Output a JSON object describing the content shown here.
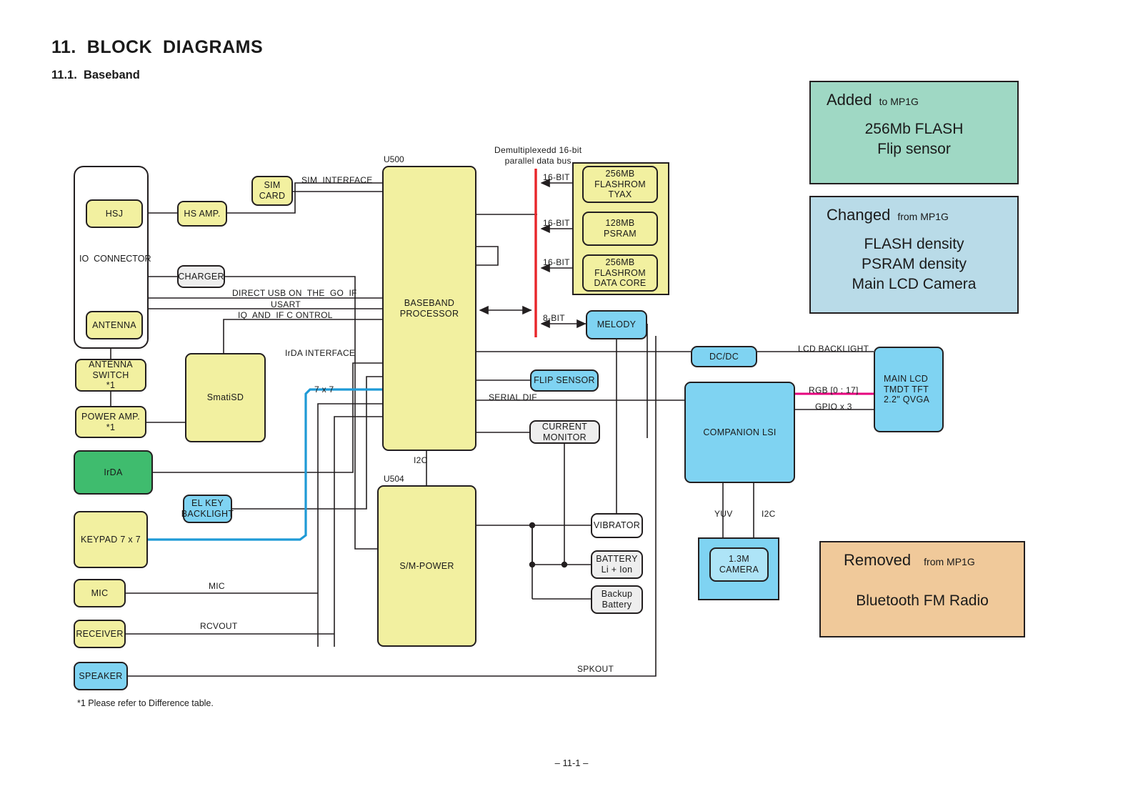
{
  "page": {
    "title": "11.  BLOCK  DIAGRAMS",
    "subtitle": "11.1.  Baseband",
    "footnote": "*1 Please refer to Difference table.",
    "footer": "– 11-1 –"
  },
  "colors": {
    "yellow_block": "#f2f0a0",
    "blue_block": "#7fd3f2",
    "green_block": "#3fbc6e",
    "grey_block": "#eeeeee",
    "white_block": "#ffffff",
    "light_blue_block": "#aee4f7",
    "bus_red": "#e8252a",
    "rgb_magenta": "#e6007e",
    "keypad_blue": "#1e9ad6",
    "outline": "#231f20",
    "legend_added": "#9fd8c4",
    "legend_changed": "#b9dbe8",
    "legend_removed": "#f0c99a"
  },
  "io_connector": {
    "label": "IO  CONNECTOR",
    "children": [
      {
        "label": "HSJ"
      },
      {
        "label": "ANTENNA"
      }
    ]
  },
  "blocks": {
    "hs_amp": "HS AMP.",
    "sim_card": "SIM\nCARD",
    "charger": "CHARGER",
    "antenna_switch": "ANTENNA\nSWITCH\n*1",
    "power_amp": "POWER  AMP.\n*1",
    "smatisd": "SmatiSD",
    "irda": "IrDA",
    "el_key_backlight": "EL KEY\nBACKLIGHT",
    "keypad": "KEYPAD  7 x 7",
    "mic": "MIC",
    "receiver": "RECEIVER",
    "speaker": "SPEAKER",
    "baseband_processor": "BASEBAND\nPROCESSOR",
    "sm_power": "S/M-POWER",
    "flip_sensor": "FLIP  SENSOR",
    "current_monitor": "CURRENT\nMONITOR",
    "vibrator": "VIBRATOR",
    "battery": "BATTERY\nLi + Ion",
    "backup_battery": "Backup\nBattery",
    "melody": "MELODY",
    "dcdc": "DC/DC",
    "companion_lsi": "COMPANION  LSI",
    "main_lcd": "MAIN  LCD\nTMDT TFT\n2.2\" QVGA",
    "camera": "1.3M CAMERA",
    "flashrom_tyax": "256MB\nFLASHROM\nTYAX",
    "psram": "128MB\nPSRAM",
    "flashrom_data_core": "256MB\nFLASHROM\nDATA  CORE"
  },
  "refdes": {
    "baseband": "U500",
    "power": "U504"
  },
  "wire_labels": {
    "bus_caption": "Demultiplexedd 16-bit\nparallel data bus",
    "sim_interface": "SIM  INTERFACE",
    "direct_usb": "DIRECT USB ON  THE  GO  IF",
    "usart": "USART",
    "iq_if_control": "IQ  AND  IF C ONTROL",
    "irda_interface": "IrDA INTERFACE",
    "keypad_7x7": "7 x 7",
    "serial_dif": "SERIAL DIF",
    "i2c_power": "I2C",
    "mic": "MIC",
    "rcvout": "RCVOUT",
    "spkout": "SPKOUT",
    "bit16_a": "16-BIT",
    "bit16_b": "16-BIT",
    "bit16_c": "16-BIT",
    "bit8": "8-BIT",
    "lcd_backlight": "LCD BACKLIGHT",
    "rgb": "RGB [0 : 17]",
    "gpio": "GPIO x 3",
    "yuv": "YUV",
    "i2c_camera": "I2C"
  },
  "legend": {
    "added": {
      "head": "Added",
      "sub": "to  MP1G",
      "body": "256Mb FLASH\nFlip sensor"
    },
    "changed": {
      "head": "Changed",
      "sub": "from  MP1G",
      "body": "FLASH density\nPSRAM density\nMain LCD Camera"
    },
    "removed": {
      "head": "Removed",
      "sub": "from  MP1G",
      "body": "Bluetooth FM Radio"
    }
  }
}
